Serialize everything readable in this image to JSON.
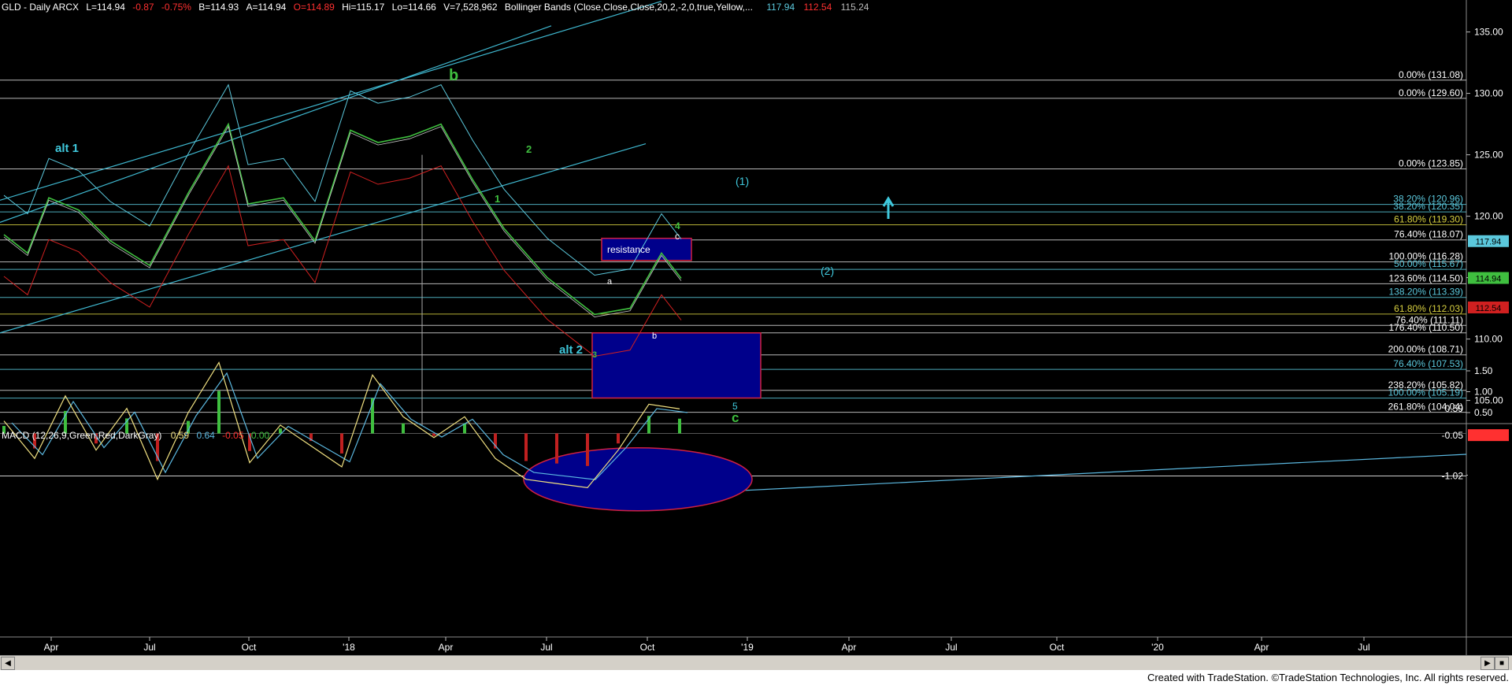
{
  "header": {
    "symbol": "GLD - Daily  ARCX",
    "last": "L=114.94",
    "change": "-0.87",
    "change_pct": "-0.75%",
    "bid": "B=114.93",
    "ask": "A=114.94",
    "open": "O=114.89",
    "hi": "Hi=115.17",
    "lo": "Lo=114.66",
    "vol": "V=7,528,962",
    "bb_label": "Bollinger Bands (Close,Close,Close,20,2,-2,0,true,Yellow,...",
    "bb_v1": "117.94",
    "bb_v2": "112.54",
    "bb_v3": "115.24"
  },
  "macd_header": {
    "label": "MACD (12,26,9,Green,Red,DarkGray)",
    "v1": "0.59",
    "v2": "0.64",
    "v3": "-0.05",
    "v4": "0.00"
  },
  "colors": {
    "price": "#3fbf3f",
    "upper_band": "#5bc8dc",
    "lower_band": "#d02020",
    "mid_band": "#c8c8c8",
    "channel": "#3fb8d0",
    "fib_line": "#d8d8d8",
    "macd_line": "#f0e080",
    "signal_line": "#5bb8e0",
    "hist_pos": "#3fbf3f",
    "hist_neg": "#c02020",
    "box_fill": "#00008b",
    "box_edge": "#d02040"
  },
  "chart_data": {
    "type": "line",
    "title": "GLD - Daily  ARCX",
    "ylim": [
      102.5,
      136
    ],
    "y_ticks": [
      {
        "label": "135.00",
        "v": 135
      },
      {
        "label": "130.00",
        "v": 130
      },
      {
        "label": "125.00",
        "v": 125
      },
      {
        "label": "120.00",
        "v": 120
      },
      {
        "label": "115.00",
        "v": 115
      },
      {
        "label": "110.00",
        "v": 110
      },
      {
        "label": "105.00",
        "v": 105
      }
    ],
    "x_ticks": [
      "Apr",
      "Jul",
      "Oct",
      "'18",
      "Apr",
      "Jul",
      "Oct",
      "'19",
      "Apr",
      "Jul",
      "Oct",
      "'20",
      "Apr",
      "Jul"
    ],
    "price_series": [
      {
        "date": "2017-02",
        "close": 118.5
      },
      {
        "date": "2017-03",
        "close": 117.0
      },
      {
        "date": "2017-04",
        "close": 121.5
      },
      {
        "date": "2017-05",
        "close": 120.5
      },
      {
        "date": "2017-06",
        "close": 118.0
      },
      {
        "date": "2017-07",
        "close": 116.0
      },
      {
        "date": "2017-08",
        "close": 122.0
      },
      {
        "date": "2017-09",
        "close": 127.5
      },
      {
        "date": "2017-10",
        "close": 121.0
      },
      {
        "date": "2017-11",
        "close": 121.5
      },
      {
        "date": "2017-12",
        "close": 118.0
      },
      {
        "date": "2018-01",
        "close": 127.0
      },
      {
        "date": "2018-02",
        "close": 126.0
      },
      {
        "date": "2018-03",
        "close": 126.5
      },
      {
        "date": "2018-04",
        "close": 127.5
      },
      {
        "date": "2018-05",
        "close": 123.0
      },
      {
        "date": "2018-06",
        "close": 119.0
      },
      {
        "date": "2018-07",
        "close": 115.0
      },
      {
        "date": "2018-08",
        "close": 112.0
      },
      {
        "date": "2018-09",
        "close": 112.5
      },
      {
        "date": "2018-10",
        "close": 117.0
      },
      {
        "date": "2018-10-31",
        "close": 114.94
      }
    ],
    "last_values": [
      {
        "label": "117.94",
        "v": 117.94,
        "color": "#5bc8dc"
      },
      {
        "label": "114.94",
        "v": 114.94,
        "color": "#3fbf3f"
      },
      {
        "label": "112.54",
        "v": 112.54,
        "color": "#d02020"
      }
    ],
    "fib_labels": [
      {
        "label": "0.00% (131.08)",
        "v": 131.08,
        "color": "#ffffff"
      },
      {
        "label": "0.00% (129.60)",
        "v": 129.6,
        "color": "#ffffff"
      },
      {
        "label": "0.00% (123.85)",
        "v": 123.85,
        "color": "#ffffff"
      },
      {
        "label": "38.20% (120.96)",
        "v": 120.96,
        "color": "#5bc8dc"
      },
      {
        "label": "38.20% (120.35)",
        "v": 120.35,
        "color": "#5bc8dc"
      },
      {
        "label": "61.80% (119.30)",
        "v": 119.3,
        "color": "#d8d040"
      },
      {
        "label": "76.40% (118.07)",
        "v": 118.07,
        "color": "#ffffff"
      },
      {
        "label": "100.00% (116.28)",
        "v": 116.28,
        "color": "#ffffff"
      },
      {
        "label": "50.00% (115.67)",
        "v": 115.67,
        "color": "#5bc8dc"
      },
      {
        "label": "123.60% (114.50)",
        "v": 114.5,
        "color": "#ffffff"
      },
      {
        "label": "138.20% (113.39)",
        "v": 113.39,
        "color": "#5bc8dc"
      },
      {
        "label": "61.80% (112.03)",
        "v": 112.03,
        "color": "#d8d040"
      },
      {
        "label": "76.40% (111.11)",
        "v": 111.11,
        "color": "#ffffff"
      },
      {
        "label": "176.40% (110.50)",
        "v": 110.5,
        "color": "#ffffff"
      },
      {
        "label": "200.00% (108.71)",
        "v": 108.71,
        "color": "#ffffff"
      },
      {
        "label": "76.40% (107.53)",
        "v": 107.53,
        "color": "#5bc8dc"
      },
      {
        "label": "238.20% (105.82)",
        "v": 105.82,
        "color": "#ffffff"
      },
      {
        "label": "100.00% (105.19)",
        "v": 105.19,
        "color": "#5bc8dc"
      },
      {
        "label": "261.80% (104.04)",
        "v": 104.04,
        "color": "#ffffff"
      }
    ],
    "wave_labels": [
      {
        "text": "b",
        "color": "#3fbf3f"
      },
      {
        "text": "alt 1",
        "color": "#3fc8dc"
      },
      {
        "text": "2",
        "color": "#3fbf3f"
      },
      {
        "text": "1",
        "color": "#3fbf3f"
      },
      {
        "text": "(1)",
        "color": "#3fc8dc"
      },
      {
        "text": "4",
        "color": "#3fbf3f"
      },
      {
        "text": "c",
        "color": "#ffffff"
      },
      {
        "text": "resistance",
        "color": "#ffffff"
      },
      {
        "text": "(2)",
        "color": "#3fc8dc"
      },
      {
        "text": "a",
        "color": "#ffffff"
      },
      {
        "text": "b",
        "color": "#ffffff"
      },
      {
        "text": "alt 2",
        "color": "#3fc8dc"
      },
      {
        "text": "3",
        "color": "#3fbf3f"
      },
      {
        "text": "5",
        "color": "#3fc8dc"
      },
      {
        "text": "c",
        "color": "#3fbf3f"
      }
    ],
    "macd": {
      "ylim": [
        -1.5,
        1.75
      ],
      "y_ticks": [
        {
          "label": "1.50",
          "v": 1.5
        },
        {
          "label": "1.00",
          "v": 1.0
        },
        {
          "label": "0.50",
          "v": 0.5
        },
        {
          "label": "-1.00",
          "v": -1.0
        }
      ],
      "markers": [
        {
          "label": "0.59",
          "v": 0.59
        },
        {
          "label": "-0.05",
          "v": -0.05
        },
        {
          "label": "-1.02",
          "v": -1.02
        }
      ]
    }
  },
  "footer": {
    "text": "Created with TradeStation. ©TradeStation Technologies, Inc. All rights reserved."
  }
}
